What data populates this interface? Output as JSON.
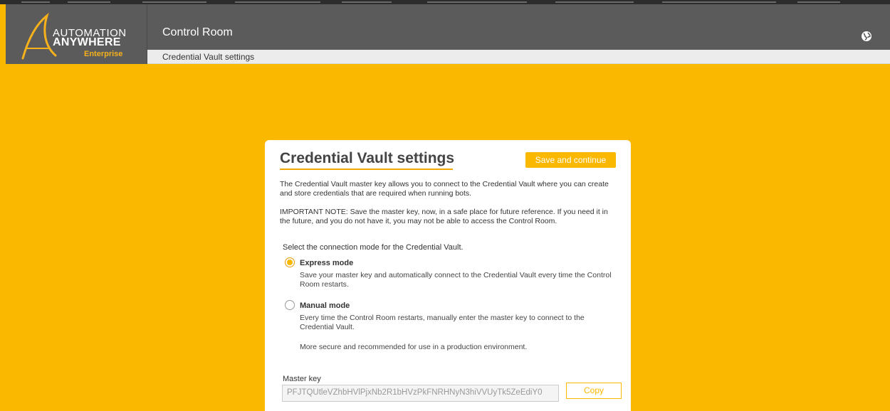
{
  "brand": {
    "line1": "AUTOMATION",
    "line2": "ANYWHERE",
    "line3": "Enterprise",
    "accent_color": "#f6b11b"
  },
  "header": {
    "app_title": "Control Room",
    "globe_icon": "globe-icon"
  },
  "subbar": {
    "breadcrumb": "Credential Vault settings"
  },
  "card": {
    "title": "Credential Vault settings",
    "save_label": "Save and continue",
    "paragraph1": "The Credential Vault master key allows you to connect to the Credential Vault where you can create and store credentials that are required when running bots.",
    "paragraph2": "IMPORTANT NOTE: Save the master key, now, in a safe place for future reference. If you need it in the future, and you do not have it, you may not be able to access the Control Room.",
    "select_label": "Select the connection mode for the Credential Vault.",
    "options": [
      {
        "title": "Express mode",
        "description": "Save your master key and automatically connect to the Credential Vault every time the Control Room restarts.",
        "selected": true
      },
      {
        "title": "Manual mode",
        "description": "Every time the Control Room restarts, manually enter the master key to connect to the Credential Vault.",
        "note": "More secure and recommended for use in a production environment.",
        "selected": false
      }
    ],
    "master_key_label": "Master key",
    "master_key_value": "PFJTQUtleVZhbHVlPjxNb2R1bHVzPkFNRHNyN3hiVVUyTk5ZeEdiY0",
    "copy_label": "Copy"
  },
  "colors": {
    "background": "#fbb800",
    "header": "#5b5b5b",
    "accent": "#fbb800"
  }
}
